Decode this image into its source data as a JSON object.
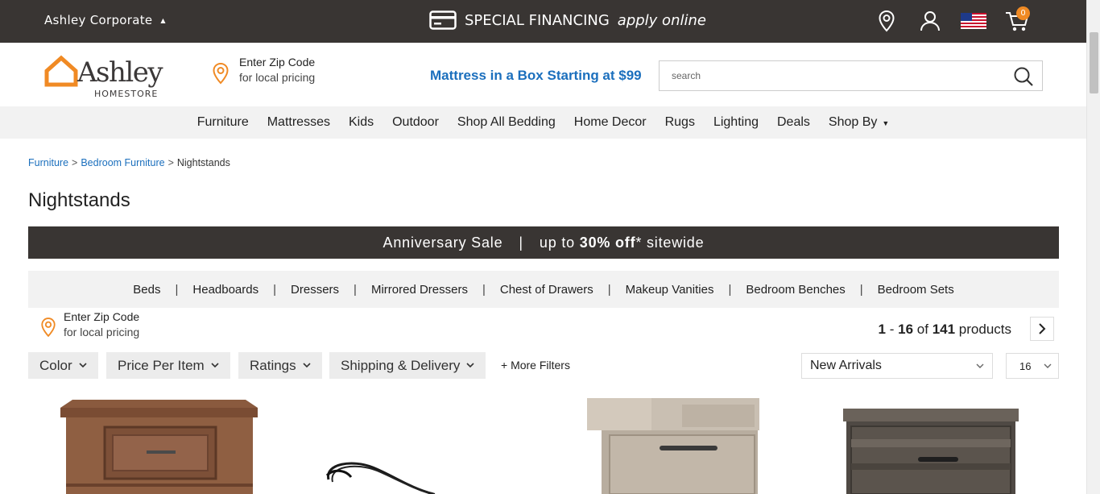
{
  "topbar": {
    "corporate_label": "Ashley Corporate",
    "financing_label": "SPECIAL FINANCING",
    "financing_link": "apply online",
    "cart_count": "0"
  },
  "header": {
    "logo_word": "Ashley",
    "logo_sub": "HOMESTORE",
    "zip_title": "Enter Zip Code",
    "zip_sub": "for local pricing",
    "promo": "Mattress in a Box Starting at $99",
    "search_placeholder": "search"
  },
  "nav": {
    "items": [
      "Furniture",
      "Mattresses",
      "Kids",
      "Outdoor",
      "Shop All Bedding",
      "Home Decor",
      "Rugs",
      "Lighting",
      "Deals",
      "Shop By"
    ]
  },
  "breadcrumb": {
    "items": [
      "Furniture",
      "Bedroom Furniture",
      "Nightstands"
    ],
    "separator": ">"
  },
  "page_title": "Nightstands",
  "sale_banner": {
    "left": "Anniversary Sale",
    "divider": "|",
    "right_prefix": "up to",
    "right_bold": "30% off",
    "right_suffix": "* sitewide"
  },
  "subcategories": {
    "items": [
      "Beds",
      "Headboards",
      "Dressers",
      "Mirrored Dressers",
      "Chest of Drawers",
      "Makeup Vanities",
      "Bedroom Benches",
      "Bedroom Sets"
    ],
    "separator": "|"
  },
  "local_pricing": {
    "title": "Enter Zip Code",
    "sub": "for local pricing"
  },
  "results": {
    "start": "1",
    "dash": "-",
    "end": "16",
    "of": "of",
    "total": "141",
    "unit": "products"
  },
  "filters": {
    "items": [
      "Color",
      "Price Per Item",
      "Ratings",
      "Shipping & Delivery"
    ],
    "more": "+ More Filters"
  },
  "sort": {
    "selected": "New Arrivals"
  },
  "per_page": {
    "selected": "16"
  },
  "colors": {
    "topbar_bg": "#393533",
    "accent_orange": "#f08a24",
    "link_blue": "#1b6fbd",
    "nav_bg": "#f2f2f2"
  }
}
